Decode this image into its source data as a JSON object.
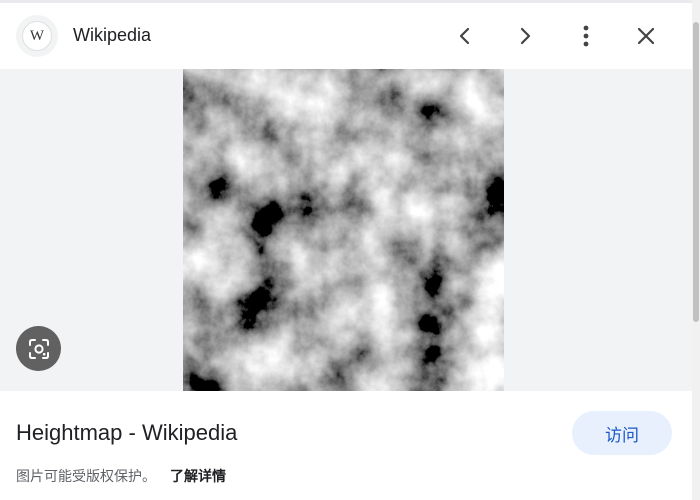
{
  "header": {
    "site_logo_letter": "W",
    "site_name": "Wikipedia",
    "icons": [
      "chevron-left-icon",
      "chevron-right-icon",
      "more-vert-icon",
      "close-icon"
    ]
  },
  "image": {
    "description_icon": "lens-icon"
  },
  "result": {
    "title": "Heightmap - Wikipedia",
    "visit_label": "访问",
    "copyright_notice": "图片可能受版权保护。",
    "learn_more_label": "了解详情"
  },
  "colors": {
    "accent": "#1a56c7",
    "visit_bg": "#e8f0fe",
    "panel_bg": "#f1f3f4"
  }
}
